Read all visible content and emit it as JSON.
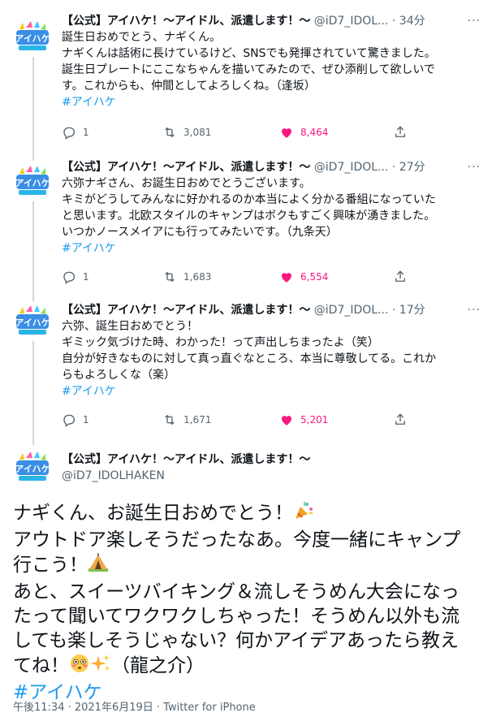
{
  "account": {
    "name": "【公式】アイハケ！～アイドル、派遣します！～",
    "handle": "@iD7_IDOLHAKEN",
    "handle_truncated": "@iD7_IDOL...",
    "avatar_text": "アイハケ"
  },
  "more_label": "···",
  "tweets": [
    {
      "time": "· 34分",
      "lines": [
        "誕生日おめでとう、ナギくん。",
        "ナギくんは話術に長けているけど、SNSでも発揮されていて驚きました。",
        "誕生日プレートにここなちゃんを描いてみたので、ぜひ添削して欲しいで",
        "す。これからも、仲間としてよろしくね。（逢坂）"
      ],
      "hashtag": "#アイハケ",
      "replies": "1",
      "retweets": "3,081",
      "likes": "8,464"
    },
    {
      "time": "· 27分",
      "lines": [
        "六弥ナギさん、お誕生日おめでとうございます。",
        "キミがどうしてみんなに好かれるのか本当によく分かる番組になっていた",
        "と思います。北欧スタイルのキャンプはボクもすごく興味が湧きました。",
        "いつかノースメイアにも行ってみたいです。（九条天）"
      ],
      "hashtag": "#アイハケ",
      "replies": "1",
      "retweets": "1,683",
      "likes": "6,554"
    },
    {
      "time": "· 17分",
      "lines": [
        "六弥、誕生日おめでとう！",
        "ギミック気づけた時、わかった！って声出しちまったよ（笑）",
        "自分が好きなものに対して真っ直ぐなところ、本当に尊敬してる。これか",
        "らもよろしくな（楽）"
      ],
      "hashtag": "#アイハケ",
      "replies": "1",
      "retweets": "1,671",
      "likes": "5,201"
    }
  ],
  "main_tweet": {
    "line1": "ナギくん、お誕生日おめでとう！",
    "line2": "アウトドア楽しそうだったなあ。今度一緒にキャンプ",
    "line3": "行こう！",
    "line4": "あと、スイーツバイキング＆流しそうめん大会になっ",
    "line5": "たって聞いてワクワクしちゃった！そうめん以外も流",
    "line6": "しても楽しそうじゃない？何かアイデアあったら教え",
    "line7": "てね！",
    "line7_suffix": "（龍之介）",
    "hashtag": "#アイハケ",
    "meta": "午後11:34 · 2021年6月19日 · Twitter for iPhone",
    "emojis": [
      "party-popper",
      "tent",
      "flushed-face",
      "sparkles"
    ]
  },
  "colors": {
    "accent": "#1d9bf0",
    "like": "#f91880",
    "secondary": "#536471",
    "thread": "#cfd9de"
  }
}
